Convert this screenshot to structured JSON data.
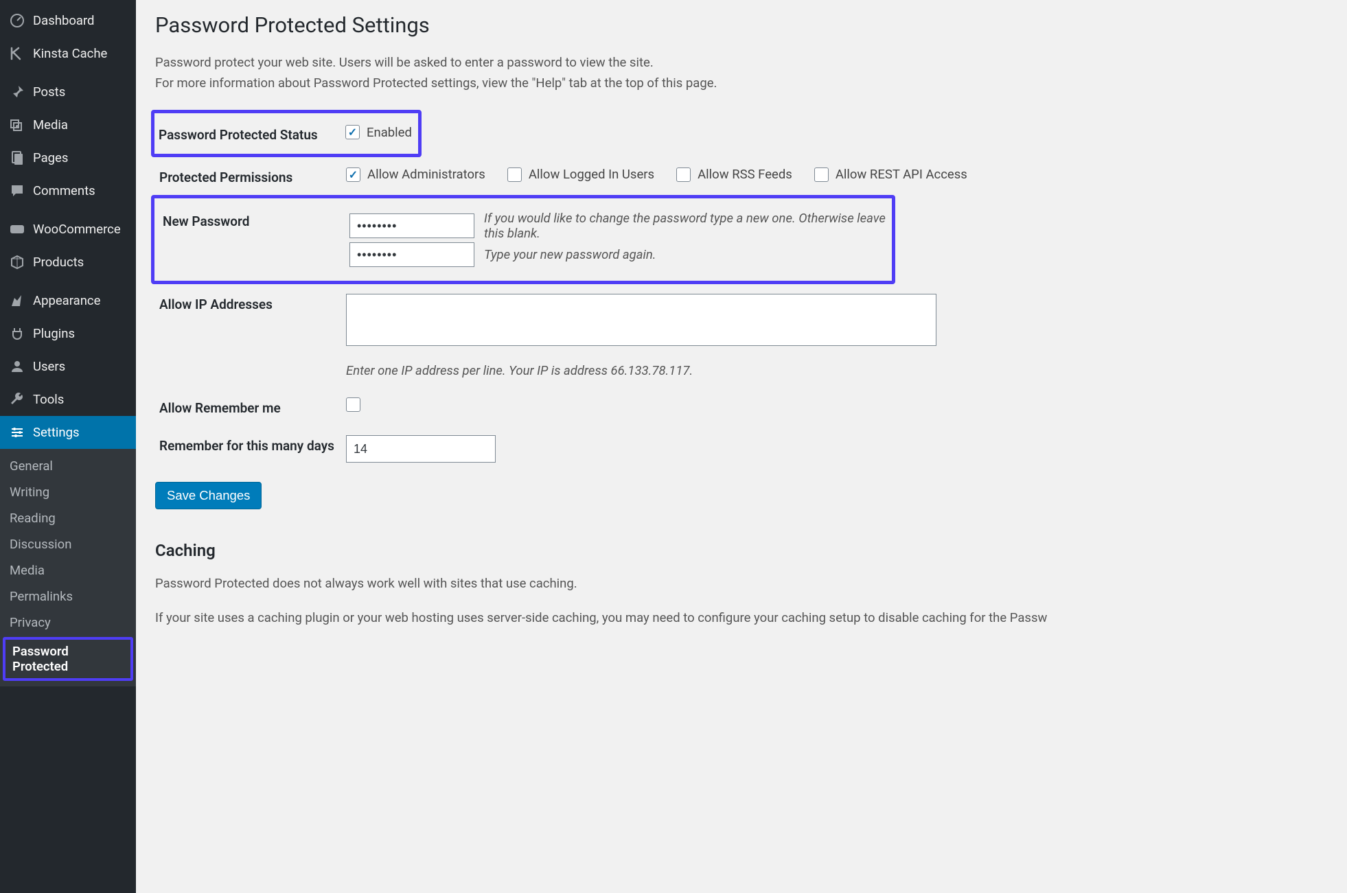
{
  "sidebar": {
    "items": [
      {
        "label": "Dashboard",
        "icon": "dashboard"
      },
      {
        "label": "Kinsta Cache",
        "icon": "kinsta"
      },
      {
        "label": "Posts",
        "icon": "pin"
      },
      {
        "label": "Media",
        "icon": "media"
      },
      {
        "label": "Pages",
        "icon": "pages"
      },
      {
        "label": "Comments",
        "icon": "comment"
      },
      {
        "label": "WooCommerce",
        "icon": "woo"
      },
      {
        "label": "Products",
        "icon": "products"
      },
      {
        "label": "Appearance",
        "icon": "appearance"
      },
      {
        "label": "Plugins",
        "icon": "plugins"
      },
      {
        "label": "Users",
        "icon": "users"
      },
      {
        "label": "Tools",
        "icon": "tools"
      },
      {
        "label": "Settings",
        "icon": "settings",
        "current": true
      }
    ],
    "submenu": [
      {
        "label": "General"
      },
      {
        "label": "Writing"
      },
      {
        "label": "Reading"
      },
      {
        "label": "Discussion"
      },
      {
        "label": "Media"
      },
      {
        "label": "Permalinks"
      },
      {
        "label": "Privacy"
      },
      {
        "label": "Password Protected",
        "current": true
      }
    ]
  },
  "page": {
    "title": "Password Protected Settings",
    "intro_line1": "Password protect your web site. Users will be asked to enter a password to view the site.",
    "intro_line2": "For more information about Password Protected settings, view the \"Help\" tab at the top of this page."
  },
  "fields": {
    "status_label": "Password Protected Status",
    "status_enabled_label": "Enabled",
    "permissions_label": "Protected Permissions",
    "perm_admin": "Allow Administrators",
    "perm_logged_in": "Allow Logged In Users",
    "perm_rss": "Allow RSS Feeds",
    "perm_rest": "Allow REST API Access",
    "new_password_label": "New Password",
    "new_password_value": "••••••••",
    "new_password_hint1": "If you would like to change the password type a new one. Otherwise leave this blank.",
    "new_password_hint2": "Type your new password again.",
    "allow_ip_label": "Allow IP Addresses",
    "ip_hint": "Enter one IP address per line. Your IP is address 66.133.78.117.",
    "allow_remember_label": "Allow Remember me",
    "remember_days_label": "Remember for this many days",
    "remember_days_value": "14",
    "save_button": "Save Changes"
  },
  "caching": {
    "heading": "Caching",
    "line1": "Password Protected does not always work well with sites that use caching.",
    "line2": "If your site uses a caching plugin or your web hosting uses server-side caching, you may need to configure your caching setup to disable caching for the Passw"
  }
}
